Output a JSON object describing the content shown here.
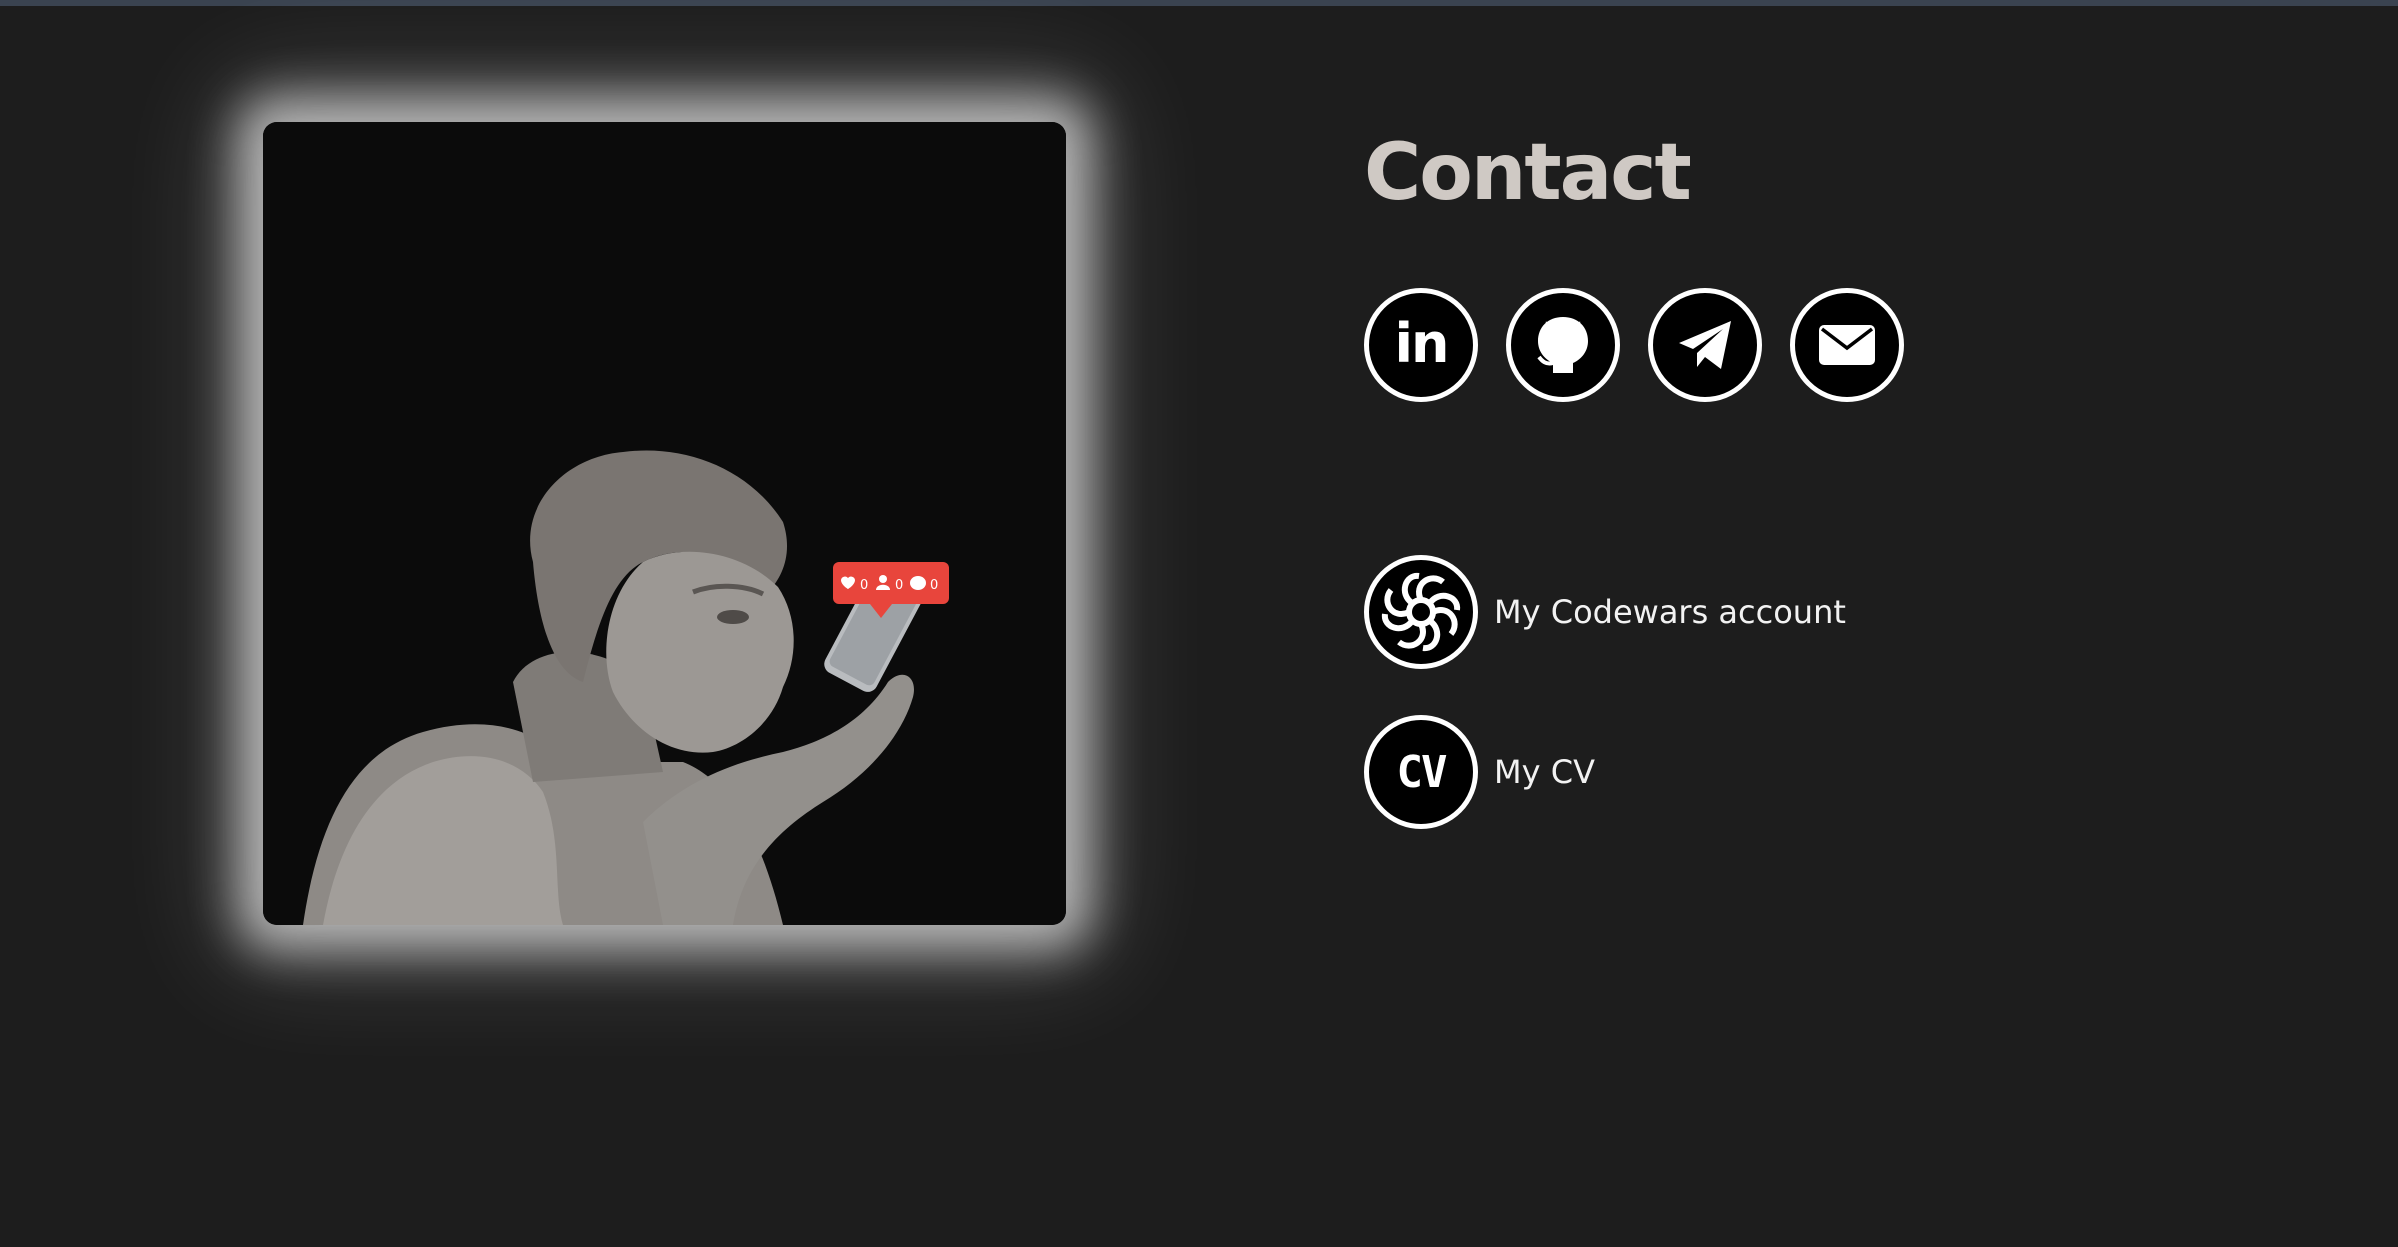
{
  "contact": {
    "title": "Contact"
  },
  "social": [
    {
      "icon": "linkedin-icon",
      "glyph": "in"
    },
    {
      "icon": "github-icon"
    },
    {
      "icon": "telegram-icon"
    },
    {
      "icon": "email-icon"
    }
  ],
  "links": {
    "codewars": {
      "icon": "codewars-icon",
      "label": "My Codewars account"
    },
    "cv": {
      "icon": "cv-icon",
      "glyph": "CV",
      "label": "My CV"
    }
  },
  "photo": {
    "notification_counts": [
      "0",
      "0",
      "0"
    ],
    "notification_color": "#e8453c"
  },
  "colors": {
    "background": "#1d1d1d",
    "title": "#cfc9c4",
    "icon_ring": "#ffffff",
    "icon_fill": "#000000"
  }
}
